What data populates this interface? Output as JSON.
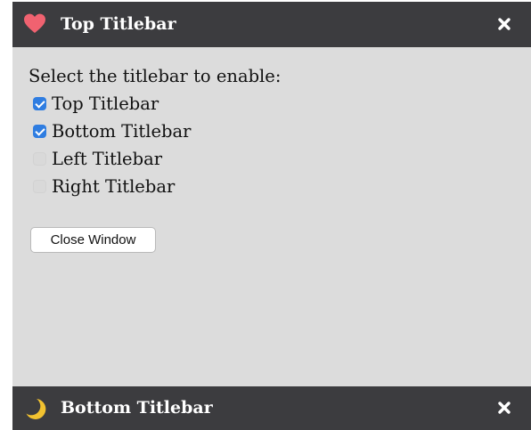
{
  "top_titlebar": {
    "icon": "heart-icon",
    "title": "Top Titlebar",
    "close_icon": "close-icon",
    "accent": "#f06270"
  },
  "bottom_titlebar": {
    "icon": "moon-icon",
    "title": "Bottom Titlebar",
    "close_icon": "close-icon",
    "accent": "#f2c230"
  },
  "content": {
    "prompt": "Select the titlebar to enable:",
    "options": [
      {
        "label": "Top Titlebar",
        "checked": true
      },
      {
        "label": "Bottom Titlebar",
        "checked": true
      },
      {
        "label": "Left Titlebar",
        "checked": false
      },
      {
        "label": "Right Titlebar",
        "checked": false
      }
    ],
    "close_button_label": "Close Window"
  },
  "colors": {
    "titlebar_bg": "#3c3c3f",
    "window_bg": "#dcdcdc",
    "checkbox_checked": "#2f7de1"
  }
}
